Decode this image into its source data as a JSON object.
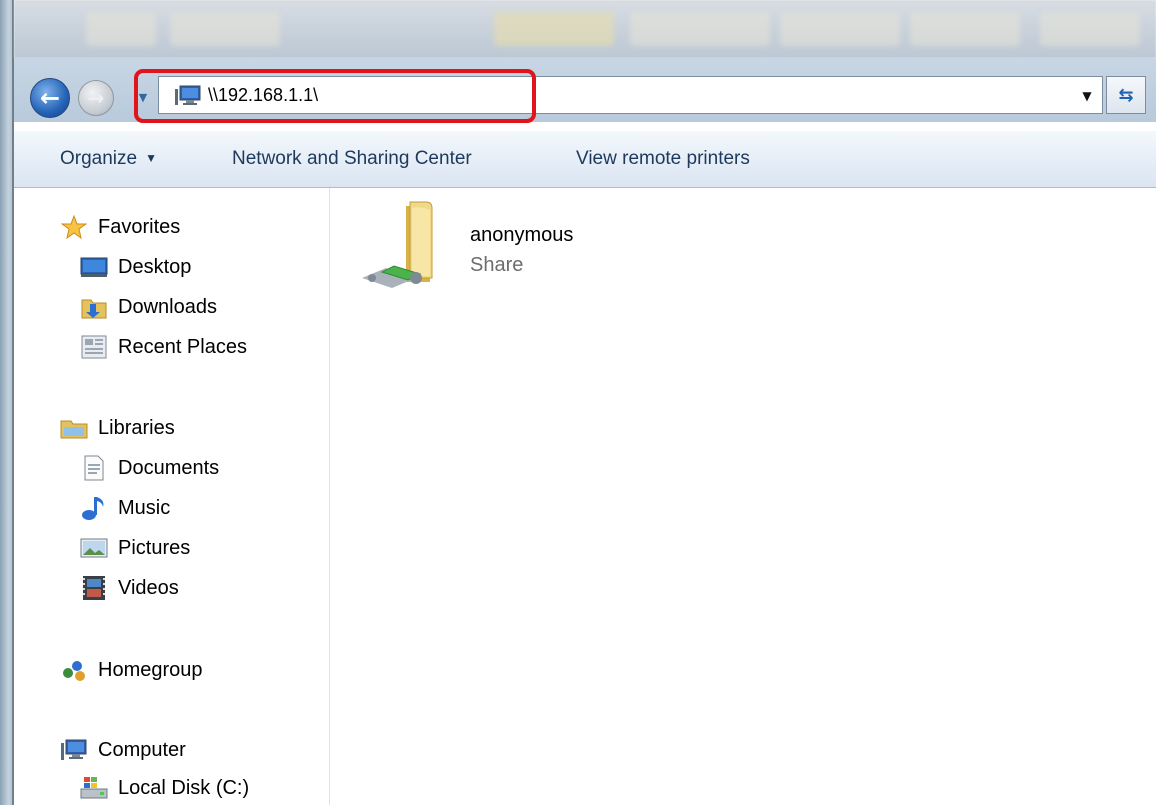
{
  "window": {
    "title": ""
  },
  "navigation": {
    "back_label": "",
    "forward_label": ""
  },
  "address_bar": {
    "path": "\\\\192.168.1.1\\",
    "highlight_color": "#e0141b"
  },
  "toolbar": {
    "organize_label": "Organize",
    "network_sharing_label": "Network and Sharing Center",
    "remote_printers_label": "View remote printers"
  },
  "sidebar": {
    "favorites": {
      "label": "Favorites",
      "items": [
        {
          "label": "Desktop",
          "icon": "desktop-icon"
        },
        {
          "label": "Downloads",
          "icon": "downloads-icon"
        },
        {
          "label": "Recent Places",
          "icon": "recent-places-icon"
        }
      ]
    },
    "libraries": {
      "label": "Libraries",
      "items": [
        {
          "label": "Documents",
          "icon": "documents-icon"
        },
        {
          "label": "Music",
          "icon": "music-icon"
        },
        {
          "label": "Pictures",
          "icon": "pictures-icon"
        },
        {
          "label": "Videos",
          "icon": "videos-icon"
        }
      ]
    },
    "homegroup": {
      "label": "Homegroup"
    },
    "computer": {
      "label": "Computer",
      "items": [
        {
          "label": "Local Disk (C:)",
          "icon": "local-disk-icon"
        }
      ]
    }
  },
  "content": {
    "items": [
      {
        "name": "anonymous",
        "type": "Share",
        "icon": "shared-folder-icon"
      }
    ]
  },
  "colors": {
    "toolbar_text": "#1e395b",
    "secondary_text": "#6d6d6d",
    "accent_blue": "#2463b6"
  }
}
